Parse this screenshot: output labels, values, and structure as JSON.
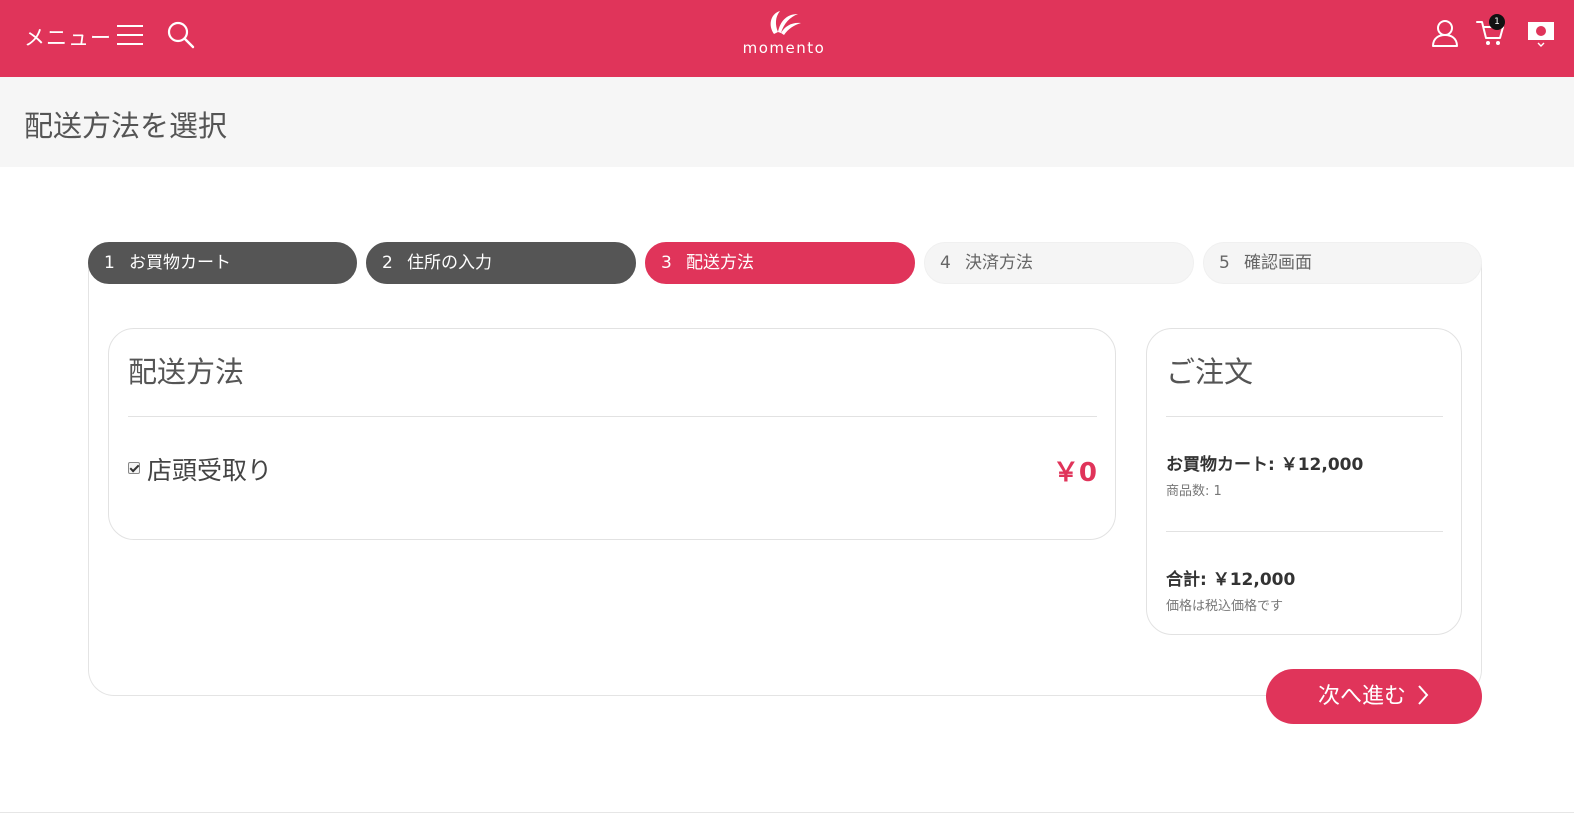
{
  "header": {
    "menu_label": "メニュー",
    "logo_text": "momento",
    "cart_count": "1",
    "brand_color": "#e0345a",
    "icons": [
      "hamburger-icon",
      "search-icon",
      "user-icon",
      "cart-icon",
      "japan-flag-icon",
      "chevron-down-icon"
    ]
  },
  "page": {
    "title": "配送方法を選択"
  },
  "steps": [
    {
      "num": "1",
      "label": "お買物カート",
      "state": "done"
    },
    {
      "num": "2",
      "label": "住所の入力",
      "state": "done"
    },
    {
      "num": "3",
      "label": "配送方法",
      "state": "active"
    },
    {
      "num": "4",
      "label": "決済方法",
      "state": "todo"
    },
    {
      "num": "5",
      "label": "確認画面",
      "state": "todo"
    }
  ],
  "shipping": {
    "title": "配送方法",
    "option_label": "店頭受取り",
    "option_checked": true,
    "option_price": "￥0"
  },
  "order": {
    "title": "ご注文",
    "cart_line": "お買物カート: ￥12,000",
    "item_count": "商品数: 1",
    "total_line": "合計: ￥12,000",
    "tax_note": "価格は税込価格です"
  },
  "actions": {
    "next_label": "次へ進む"
  }
}
